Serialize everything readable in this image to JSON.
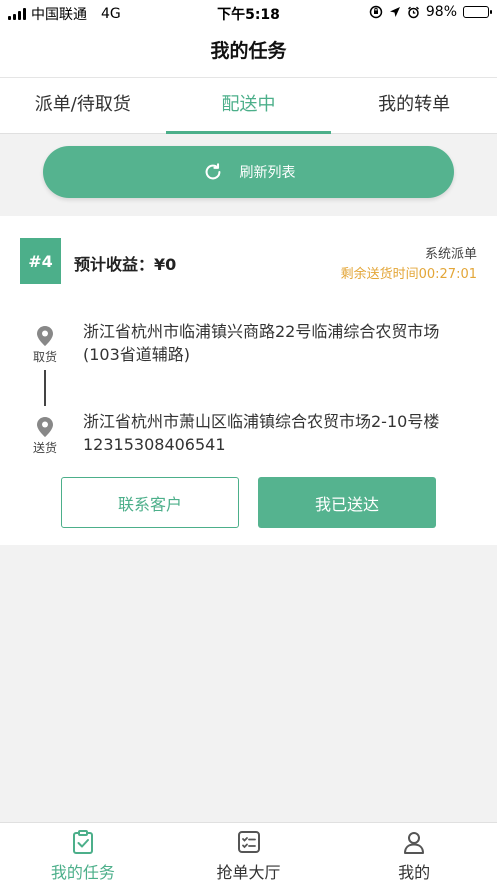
{
  "status_bar": {
    "carrier": "中国联通",
    "network": "4G",
    "time": "下午5:18",
    "battery": "98%",
    "battery_level": 0.98
  },
  "header": {
    "title": "我的任务"
  },
  "tabs": [
    {
      "label": "派单/待取货",
      "active": false
    },
    {
      "label": "配送中",
      "active": true
    },
    {
      "label": "我的转单",
      "active": false
    }
  ],
  "refresh": {
    "label": "刷新列表",
    "icon": "refresh-icon"
  },
  "order": {
    "number": "#4",
    "income": "预计收益：¥0",
    "dispatch_type": "系统派单",
    "remaining_time": "剩余送货时间00:27:01",
    "pickup": {
      "label": "取货",
      "address_line1": "浙江省杭州市临浦镇兴商路22号临浦综合农贸市场",
      "address_line2": "(103省道辅路)"
    },
    "delivery": {
      "label": "送货",
      "address_line1": "浙江省杭州市萧山区临浦镇综合农贸市场2-10号楼",
      "address_line2": "12315308406541"
    },
    "contact_button": "联系客户",
    "delivered_button": "我已送达"
  },
  "bottom_nav": [
    {
      "label": "我的任务",
      "icon": "task-clipboard-icon",
      "active": true
    },
    {
      "label": "抢单大厅",
      "icon": "order-hall-icon",
      "active": false
    },
    {
      "label": "我的",
      "icon": "profile-icon",
      "active": false
    }
  ],
  "colors": {
    "accent": "#4caf8a",
    "button": "#55b38f",
    "warning": "#e3a638"
  }
}
